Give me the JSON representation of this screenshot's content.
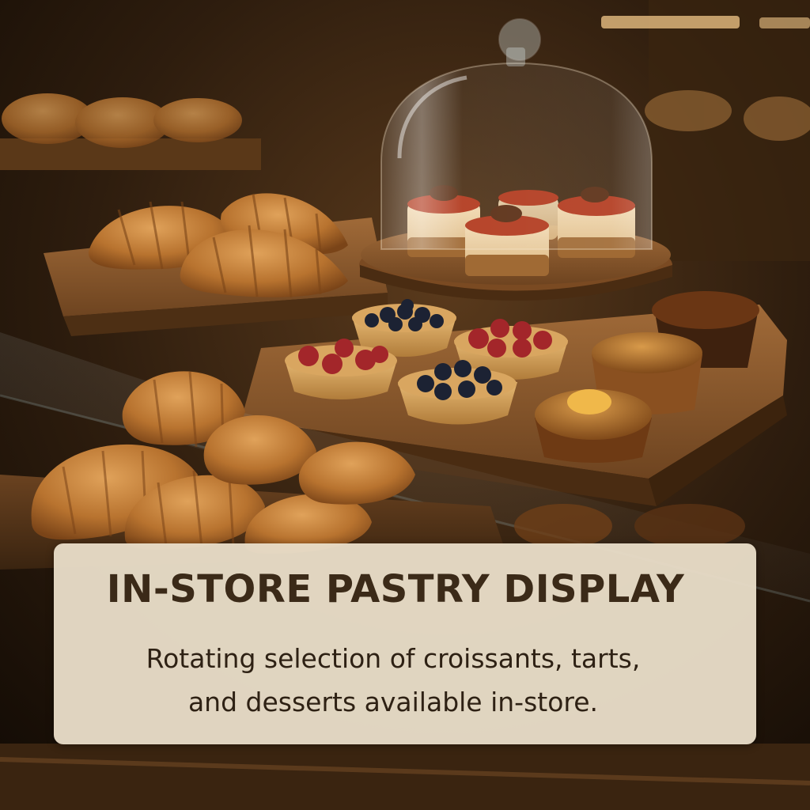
{
  "caption": {
    "title": "IN-STORE PASTRY DISPLAY",
    "description_line1": "Rotating selection of croissants, tarts,",
    "description_line2": "and desserts available in-store."
  },
  "colors": {
    "card_background": "#e8ddc8",
    "title_text": "#3b2a18",
    "body_text": "#2e2114",
    "wood": "#8a5a30",
    "croissant": "#b8732f"
  }
}
